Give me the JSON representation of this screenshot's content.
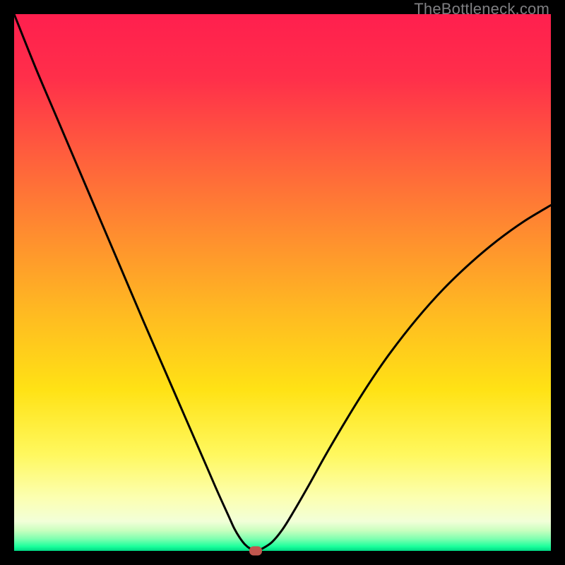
{
  "watermark": "TheBottleneck.com",
  "chart_data": {
    "type": "line",
    "title": "",
    "xlabel": "",
    "ylabel": "",
    "xlim": [
      0,
      100
    ],
    "ylim": [
      0,
      100
    ],
    "gradient_stops": [
      {
        "pos": 0.0,
        "color": "#ff1f4e"
      },
      {
        "pos": 0.12,
        "color": "#ff2f4a"
      },
      {
        "pos": 0.25,
        "color": "#ff5a3e"
      },
      {
        "pos": 0.4,
        "color": "#ff8a30"
      },
      {
        "pos": 0.55,
        "color": "#ffb822"
      },
      {
        "pos": 0.7,
        "color": "#ffe215"
      },
      {
        "pos": 0.82,
        "color": "#fff85e"
      },
      {
        "pos": 0.9,
        "color": "#fcffb0"
      },
      {
        "pos": 0.945,
        "color": "#f2ffd8"
      },
      {
        "pos": 0.962,
        "color": "#c9ffbf"
      },
      {
        "pos": 0.978,
        "color": "#7dffb0"
      },
      {
        "pos": 0.992,
        "color": "#1bff9c"
      },
      {
        "pos": 1.0,
        "color": "#00d884"
      }
    ],
    "series": [
      {
        "name": "bottleneck-curve",
        "x": [
          0,
          4,
          8,
          12,
          16,
          20,
          24,
          28,
          32,
          36,
          38,
          40,
          41,
          42,
          43,
          44,
          45,
          46,
          48,
          50,
          52,
          55,
          58,
          62,
          66,
          70,
          75,
          80,
          85,
          90,
          95,
          100
        ],
        "y": [
          100,
          90,
          80.6,
          71.2,
          61.8,
          52.4,
          43,
          33.8,
          24.6,
          15.4,
          10.8,
          6.4,
          4.2,
          2.5,
          1.2,
          0.4,
          0,
          0.3,
          1.6,
          4.0,
          7.2,
          12.4,
          17.8,
          24.6,
          31.0,
          36.8,
          43.2,
          48.8,
          53.6,
          57.8,
          61.4,
          64.4
        ]
      }
    ],
    "marker": {
      "x": 45,
      "y": 0
    }
  }
}
